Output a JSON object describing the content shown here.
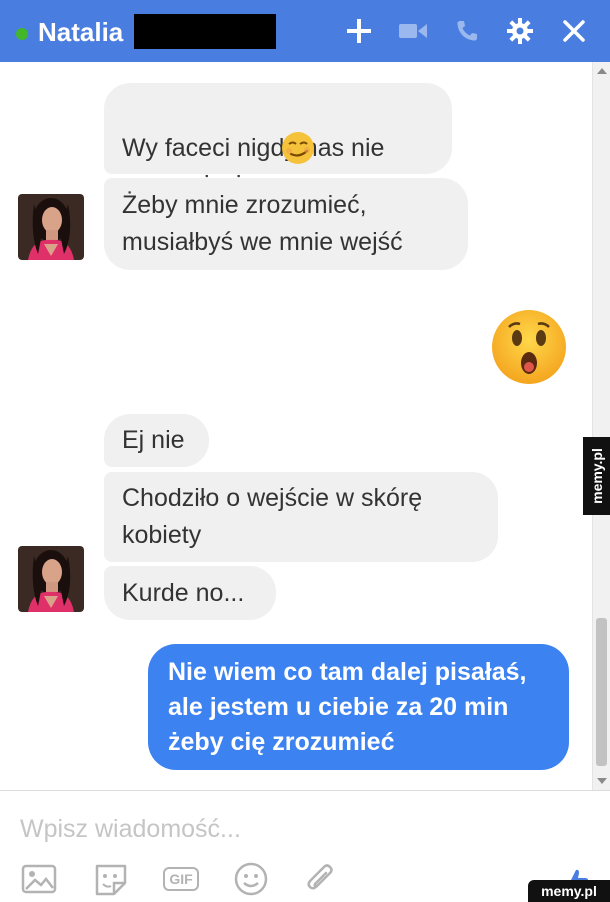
{
  "header": {
    "contact_name": "Natalia",
    "icons": [
      "add-icon",
      "video-call-icon",
      "phone-icon",
      "settings-icon",
      "close-icon"
    ]
  },
  "messages": [
    {
      "side": "left",
      "text": "Wy faceci nigdy nas nie\nzrozumiecie",
      "emoji": "smirk"
    },
    {
      "side": "left",
      "text": "Żeby mnie zrozumieć,\nmusiałbyś we mnie wejść"
    },
    {
      "side": "right",
      "emoji": "astonished"
    },
    {
      "side": "left",
      "text": "Ej nie"
    },
    {
      "side": "left",
      "text": "Chodziło o wejście w skórę\nkobiety"
    },
    {
      "side": "left",
      "text": "Kurde no..."
    },
    {
      "side": "right",
      "text": "Nie wiem co tam dalej pisałaś,\nale jestem u ciebie za 20 min\nżeby cię zrozumieć"
    }
  ],
  "composer": {
    "placeholder": "Wpisz wiadomość...",
    "toolbar_icons": [
      "photo-icon",
      "sticker-icon",
      "gif-icon",
      "emoji-icon",
      "attachment-icon",
      "like-icon"
    ],
    "gif_label": "GIF"
  },
  "watermark": "memy.pl",
  "colors": {
    "header": "#4a7de0",
    "sent_bubble": "#3c82f0",
    "received_bubble": "#f0f0f0",
    "online": "#42b72a"
  }
}
